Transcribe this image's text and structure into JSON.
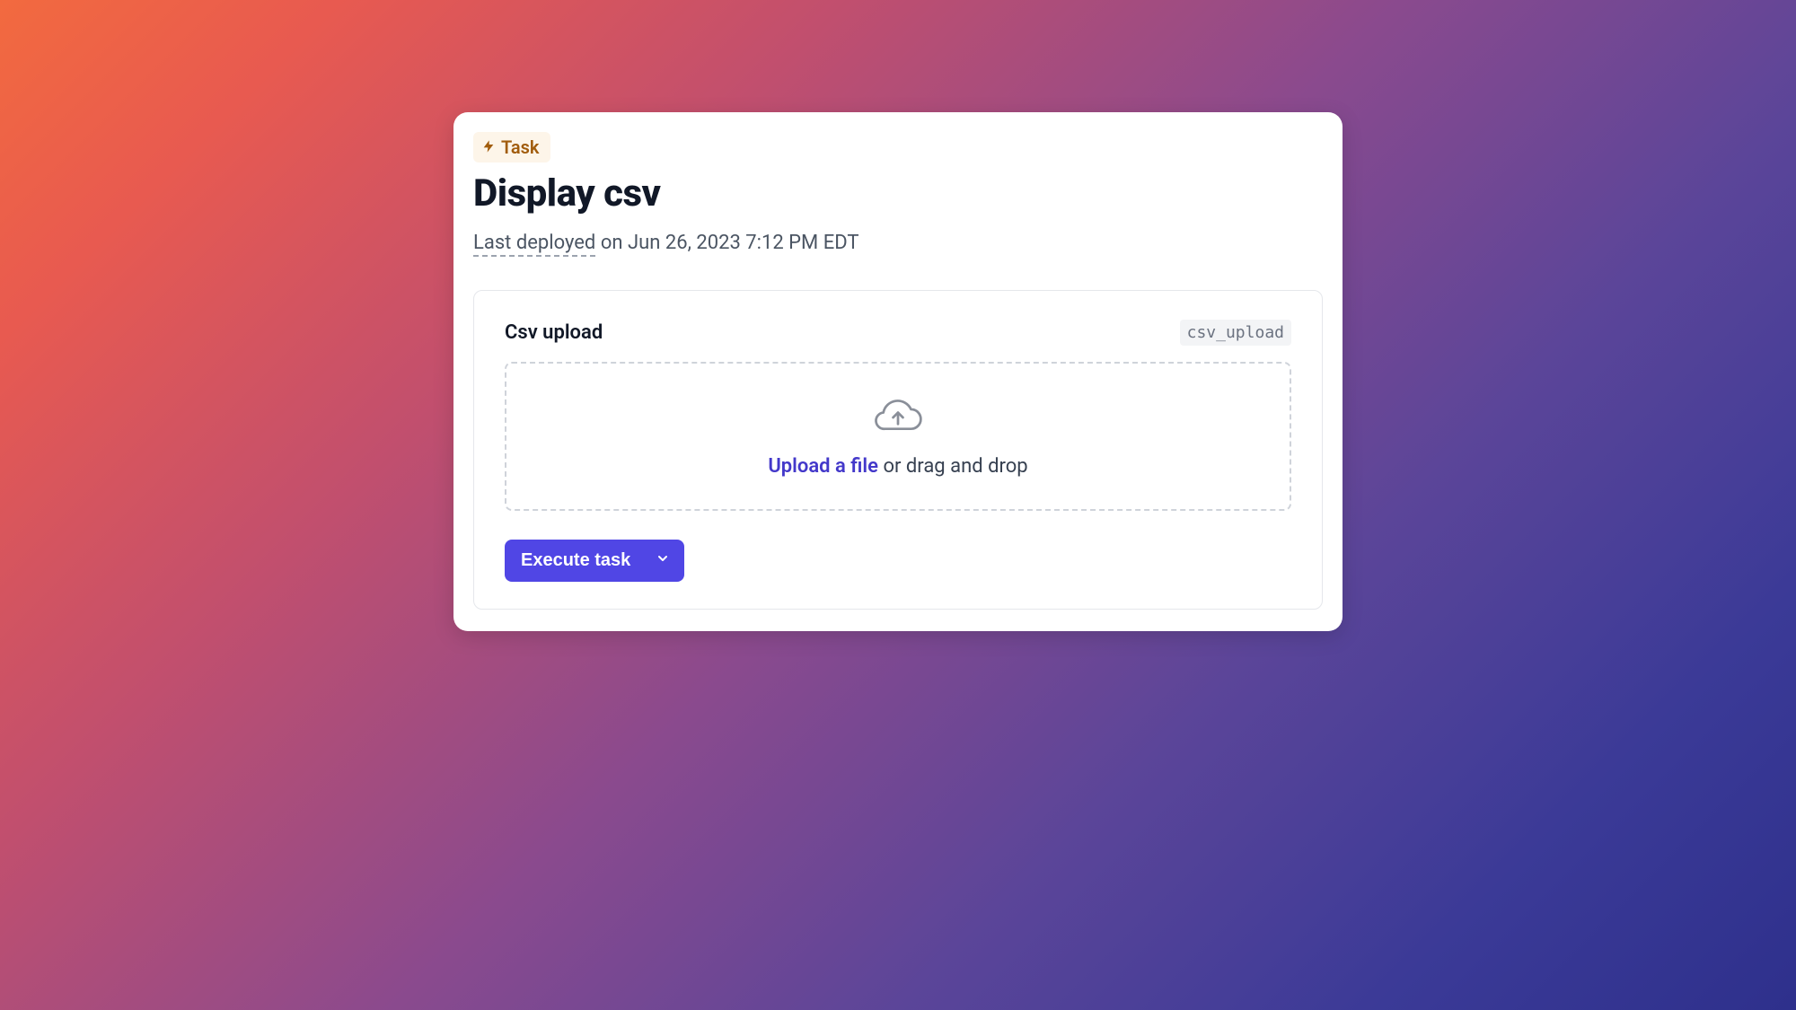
{
  "badge": {
    "label": "Task"
  },
  "title": "Display csv",
  "meta": {
    "last_deployed_label": "Last deployed",
    "on_word": "on",
    "timestamp": "Jun 26, 2023 7:12 PM EDT"
  },
  "field": {
    "label": "Csv upload",
    "slug": "csv_upload"
  },
  "dropzone": {
    "link_text": "Upload a file",
    "rest_text": " or drag and drop"
  },
  "execute": {
    "label": "Execute task"
  },
  "colors": {
    "accent": "#5046e5"
  }
}
